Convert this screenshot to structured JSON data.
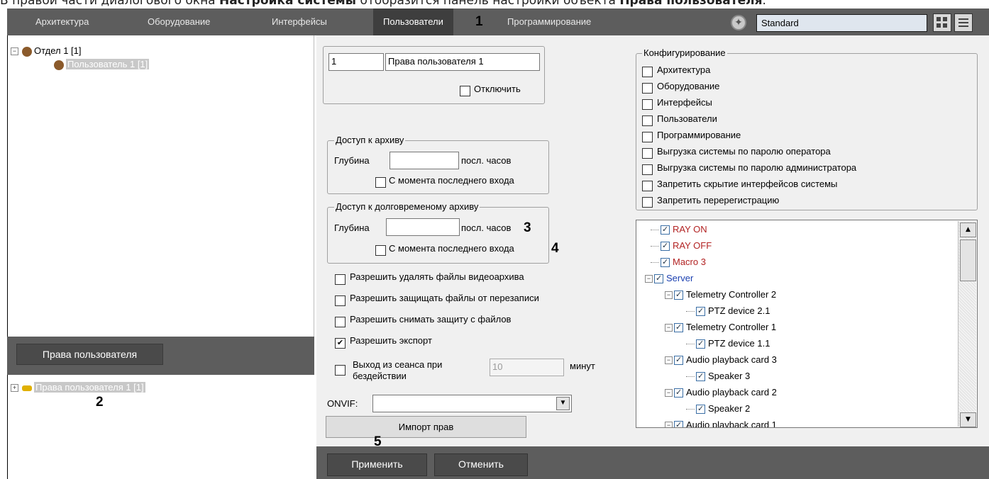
{
  "caption": {
    "prefix": "В правой части диалогового окна ",
    "bold1": "Настройка системы",
    "middle": " отобразится панель настройки объекта ",
    "bold2": "Права пользователя",
    "suffix": "."
  },
  "tabs": [
    {
      "label": "Архитектура"
    },
    {
      "label": "Оборудование"
    },
    {
      "label": "Интерфейсы"
    },
    {
      "label": "Пользователи",
      "active": true
    },
    {
      "label": "Программирование"
    }
  ],
  "markers": {
    "m1": "1",
    "m2": "2",
    "m3": "3",
    "m4": "4",
    "m5": "5"
  },
  "profile_select": {
    "value": "Standard"
  },
  "left_tree": {
    "items": [
      {
        "label": "Отдел 1 [1]"
      },
      {
        "label": "Пользователь 1 [1]"
      }
    ]
  },
  "rights_button": {
    "label": "Права пользователя"
  },
  "rights_tree": {
    "items": [
      {
        "label": "Права пользователя 1 [1]"
      }
    ]
  },
  "rights_form": {
    "id_value": "1",
    "name_value": "Права пользователя 1",
    "disable_label": "Отключить",
    "archive": {
      "title": "Доступ к архиву",
      "depth_label": "Глубина",
      "depth_value": "",
      "hours_label": "посл. часов",
      "since_label": "С момента последнего входа"
    },
    "long_archive": {
      "title": "Доступ к долговременому архиву",
      "depth_label": "Глубина",
      "depth_value": "",
      "hours_label": "посл. часов",
      "since_label": "С момента последнего входа"
    },
    "permissions": [
      {
        "label": "Разрешить удалять файлы видеоархива",
        "checked": false
      },
      {
        "label": "Разрешить защищать файлы от перезаписи",
        "checked": false
      },
      {
        "label": "Разрешить снимать защиту с файлов",
        "checked": false
      },
      {
        "label": "Разрешить экспорт",
        "checked": true
      }
    ],
    "idle_logout": {
      "label_line1": "Выход из сеанса при",
      "label_line2": "бездействии",
      "value": "10",
      "unit": "минут"
    },
    "onvif": {
      "label": "ONVIF:",
      "value": ""
    },
    "import_label": "Импорт прав"
  },
  "config": {
    "title": "Конфигурирование",
    "items": [
      {
        "label": "Архитектура"
      },
      {
        "label": "Оборудование"
      },
      {
        "label": "Интерфейсы"
      },
      {
        "label": "Пользователи"
      },
      {
        "label": "Программирование"
      },
      {
        "label": "Выгрузка системы по паролю оператора"
      },
      {
        "label": "Выгрузка системы по паролю администратора"
      },
      {
        "label": "Запретить скрытие интерфейсов системы"
      },
      {
        "label": "Запретить перерегистрацию"
      }
    ]
  },
  "object_tree": {
    "items": [
      {
        "label": "RAY ON",
        "color": "#b22222"
      },
      {
        "label": "RAY OFF",
        "color": "#b22222"
      },
      {
        "label": "Macro 3",
        "color": "#b22222"
      },
      {
        "label": "Server",
        "color": "#1a3fb0"
      },
      {
        "label": "Telemetry Controller 2",
        "color": "#000000"
      },
      {
        "label": "PTZ device 2.1",
        "color": "#000000"
      },
      {
        "label": "Telemetry Controller 1",
        "color": "#000000"
      },
      {
        "label": "PTZ device 1.1",
        "color": "#000000"
      },
      {
        "label": "Audio playback card 3",
        "color": "#000000"
      },
      {
        "label": "Speaker 3",
        "color": "#000000"
      },
      {
        "label": "Audio playback card 2",
        "color": "#000000"
      },
      {
        "label": "Speaker 2",
        "color": "#000000"
      },
      {
        "label": "Audio playback card 1",
        "color": "#000000"
      }
    ]
  },
  "bottom": {
    "apply_label": "Применить",
    "cancel_label": "Отменить"
  }
}
